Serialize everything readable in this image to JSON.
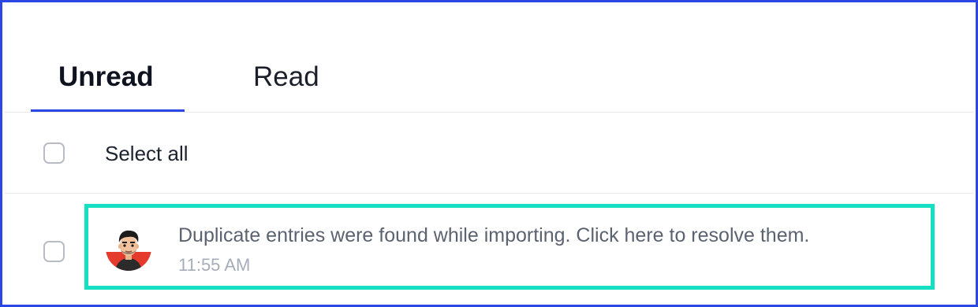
{
  "tabs": {
    "unread_label": "Unread",
    "read_label": "Read",
    "active": "Unread"
  },
  "select_all": {
    "label": "Select all",
    "checked": false
  },
  "notifications": [
    {
      "message": "Duplicate entries were found while importing. Click here to resolve them.",
      "time": "11:55 AM",
      "checked": false,
      "avatar_icon": "user-avatar-icon"
    }
  ],
  "colors": {
    "tab_underline": "#2c46e6",
    "highlight_border": "#16e0c4",
    "avatar_bg": "#e53b2c"
  }
}
